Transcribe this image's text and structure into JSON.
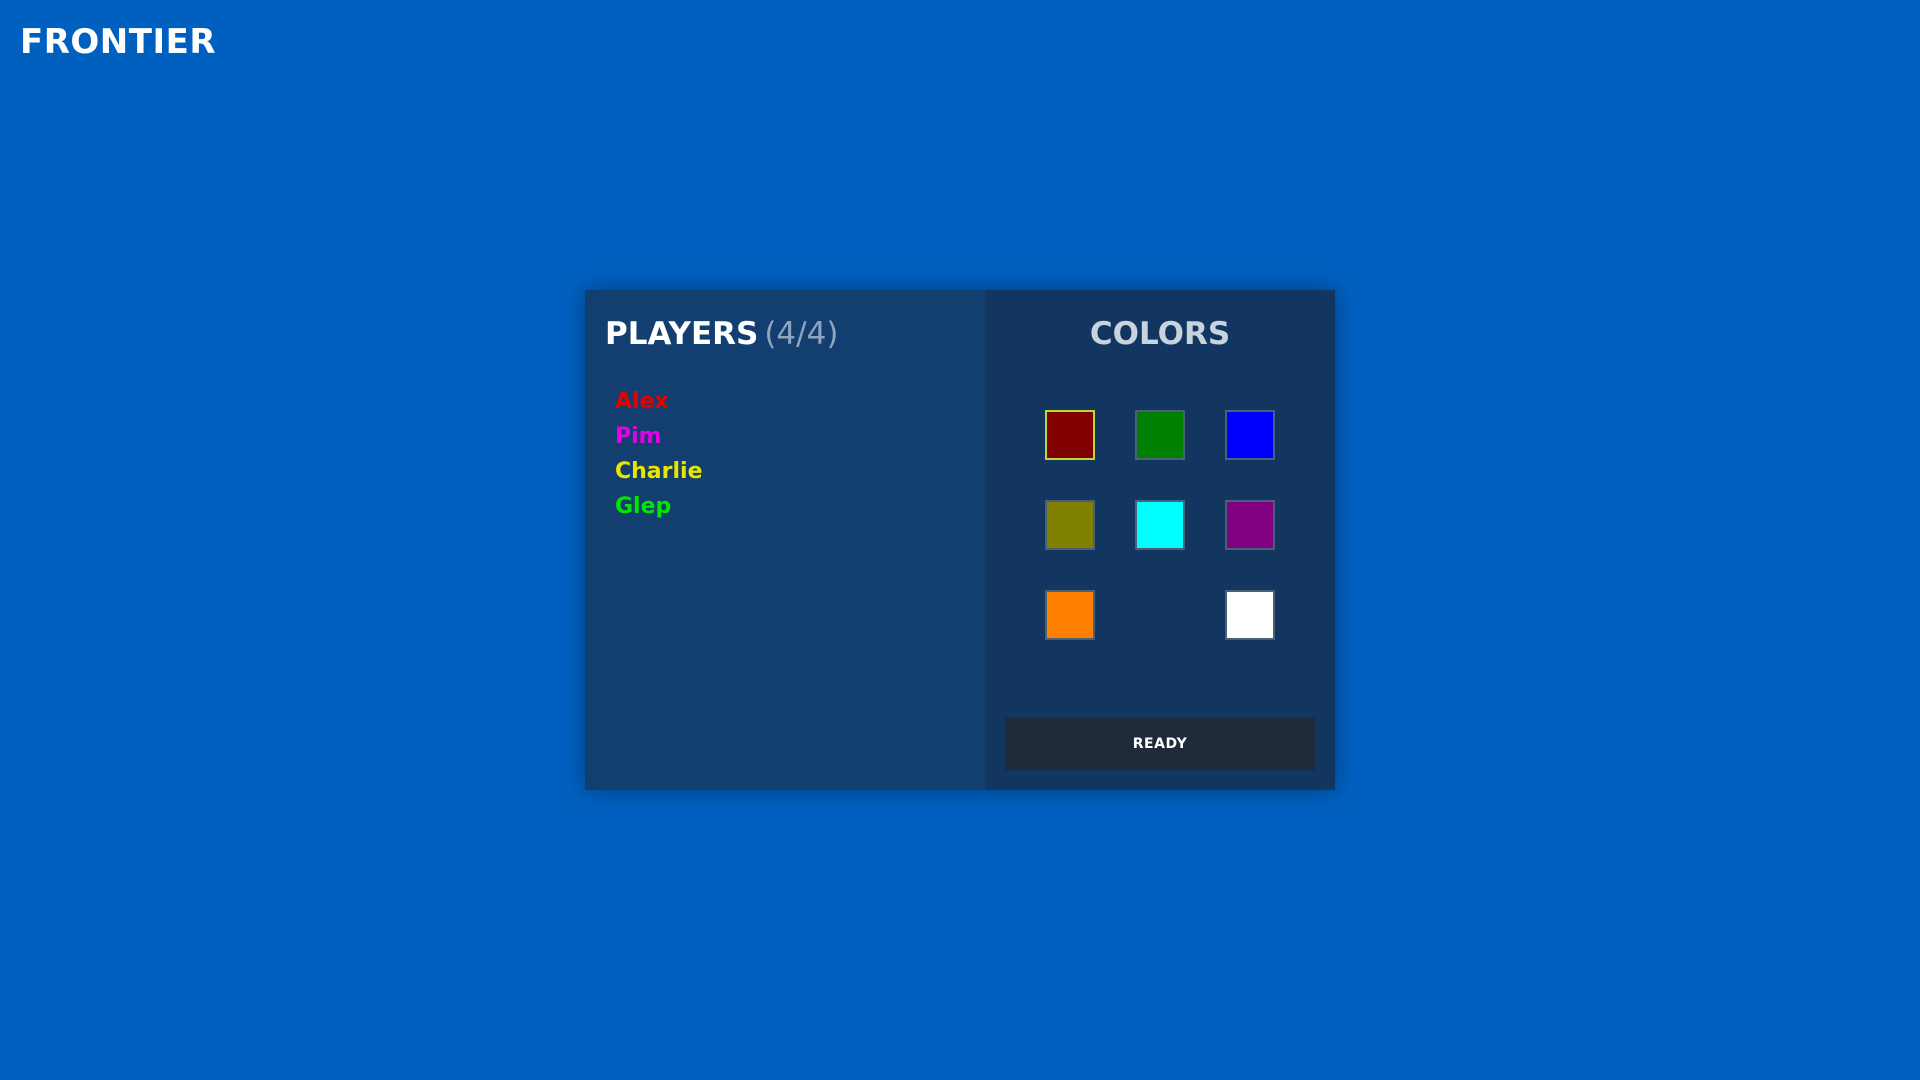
{
  "app": {
    "title": "FRONTIER"
  },
  "players": {
    "heading": "PLAYERS",
    "count": "(4/4)",
    "list": [
      {
        "name": "Alex",
        "color": "#e60000"
      },
      {
        "name": "Pim",
        "color": "#e600e6"
      },
      {
        "name": "Charlie",
        "color": "#e6e600"
      },
      {
        "name": "Glep",
        "color": "#00e600"
      }
    ]
  },
  "colors": {
    "heading": "COLORS",
    "swatches": [
      {
        "color": "#800000",
        "selected": true,
        "available": true
      },
      {
        "color": "#008000",
        "selected": false,
        "available": true
      },
      {
        "color": "#0000ff",
        "selected": false,
        "available": true
      },
      {
        "color": "#808000",
        "selected": false,
        "available": true
      },
      {
        "color": "#00ffff",
        "selected": false,
        "available": true
      },
      {
        "color": "#800080",
        "selected": false,
        "available": true
      },
      {
        "color": "#ff8000",
        "selected": false,
        "available": true
      },
      {
        "color": "",
        "selected": false,
        "available": false
      },
      {
        "color": "#ffffff",
        "selected": false,
        "available": true
      }
    ]
  },
  "actions": {
    "ready_label": "READY"
  }
}
